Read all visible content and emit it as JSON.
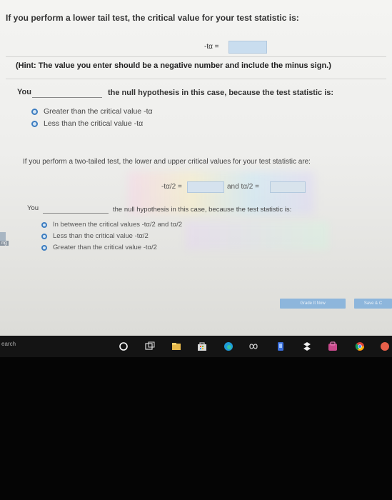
{
  "question1": {
    "title": "If you perform a lower tail test, the critical value for your test statistic is:",
    "t_label": "-tα =",
    "hint_prefix": "(Hint:",
    "hint_text": " The value you enter should be a negative number and include the minus sign.)",
    "you_label": "You",
    "decision_suffix": "the null hypothesis in this case, because the test statistic is:",
    "options": [
      "Greater than the critical value -tα",
      "Less than the critical value -tα"
    ]
  },
  "question2": {
    "title": "If you perform a two-tailed test, the lower and upper critical values for your test statistic are:",
    "lower_label": "-tα/2 =",
    "and_label": "and  tα/2 =",
    "you_label": "You",
    "decision_suffix": "the null hypothesis in this case, because the test statistic is:",
    "options": [
      "In between the critical values -tα/2 and tα/2",
      "Less than the critical value -tα/2",
      "Greater than the critical value -tα/2"
    ]
  },
  "buttons": {
    "grade": "Grade It Now",
    "save": "Save & C"
  },
  "edge_tab": "ng",
  "taskbar": {
    "search_text": "earch",
    "icons": [
      "cortana-icon",
      "task-view-icon",
      "explorer-icon",
      "store-icon",
      "edge-icon",
      "app-icon",
      "dropbox-icon",
      "photos-icon",
      "chrome-icon"
    ]
  },
  "colors": {
    "radio_border": "#3d7dc0",
    "input_fill": "#c9ddef",
    "button": "#7fb0dc",
    "taskbar": "#141414"
  }
}
